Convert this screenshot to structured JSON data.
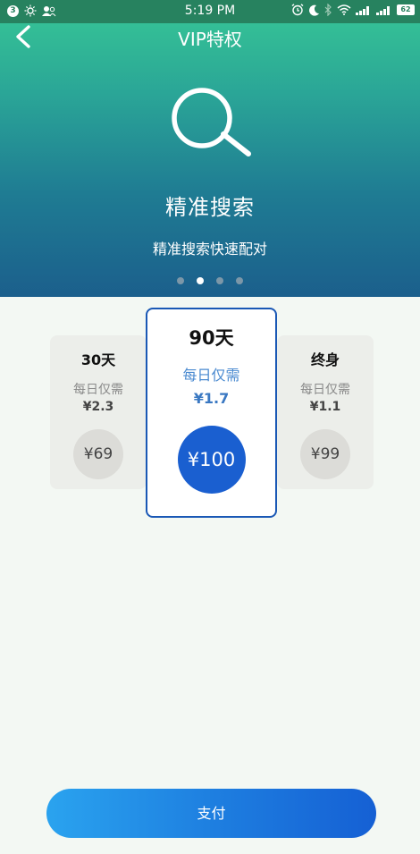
{
  "status_bar": {
    "notification_count": "3",
    "time": "5:19 PM",
    "battery": "62"
  },
  "header": {
    "title": "VIP特权"
  },
  "feature": {
    "icon": "search-icon",
    "title": "精准搜索",
    "description": "精准搜索快速配对"
  },
  "carousel": {
    "total": 4,
    "active_index": 1
  },
  "plans": {
    "left": {
      "title": "30天",
      "daily_label": "每日仅需",
      "daily_price": "¥2.3",
      "price": "¥69"
    },
    "main": {
      "title": "90天",
      "daily_label": "每日仅需",
      "daily_price": "¥1.7",
      "price": "¥100"
    },
    "right": {
      "title": "终身",
      "daily_label": "每日仅需",
      "daily_price": "¥1.1",
      "price": "¥99"
    }
  },
  "pay_button": {
    "label": "支付"
  },
  "colors": {
    "accent": "#1a5fd0",
    "hero_top": "#37c795",
    "hero_bottom": "#1b5f8c"
  }
}
